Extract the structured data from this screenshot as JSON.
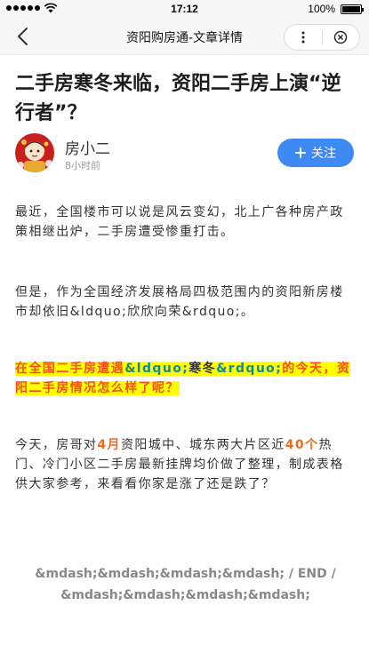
{
  "status_bar": {
    "time": "17:12",
    "battery": "100%"
  },
  "nav": {
    "title": "资阳购房通-文章详情"
  },
  "article": {
    "title": "二手房寒冬来临，资阳二手房上演“逆行者”？",
    "author_name": "房小二",
    "post_time": "8小时前",
    "follow_label": "关注",
    "p1": "最近，全国楼市可以说是风云变幻，北上广各种房产政策相继出炉，二手房遭受惨重打击。",
    "p2": "但是，作为全国经济发展格局四极范围内的资阳新房楼市却依旧&ldquo;欣欣向荣&rdquo;。",
    "p3": {
      "part1": "在全国二手房遭遇",
      "part2": "&ldquo;",
      "part3": "寒冬",
      "part4": "&rdquo;",
      "part5": "的今天，资阳二手房情况怎么样了呢？"
    },
    "p4": {
      "part1": "今天，房哥对",
      "month": "4月",
      "part2": "资阳城中、城东两大片区近",
      "count": "40个",
      "part3": "热门、冷门小区二手房最新挂牌均价做了整理，制成表格供大家参考，来看看你家是涨了还是跌了？"
    },
    "end_line1": "&mdash;&mdash;&mdash;&mdash; / END /",
    "end_line2": "&mdash;&mdash;&mdash;&mdash;"
  },
  "icons": {
    "back": "chevron-left-icon",
    "more": "more-vertical-icon",
    "close": "close-circle-icon",
    "follow_plus": "plus-icon"
  },
  "colors": {
    "accent": "#3e8af4",
    "highlight": "#ffff00",
    "emphasis_red": "#ff4a1c",
    "emphasis_teal": "#0b8b9e",
    "emphasis_orange": "#f26b1d"
  }
}
